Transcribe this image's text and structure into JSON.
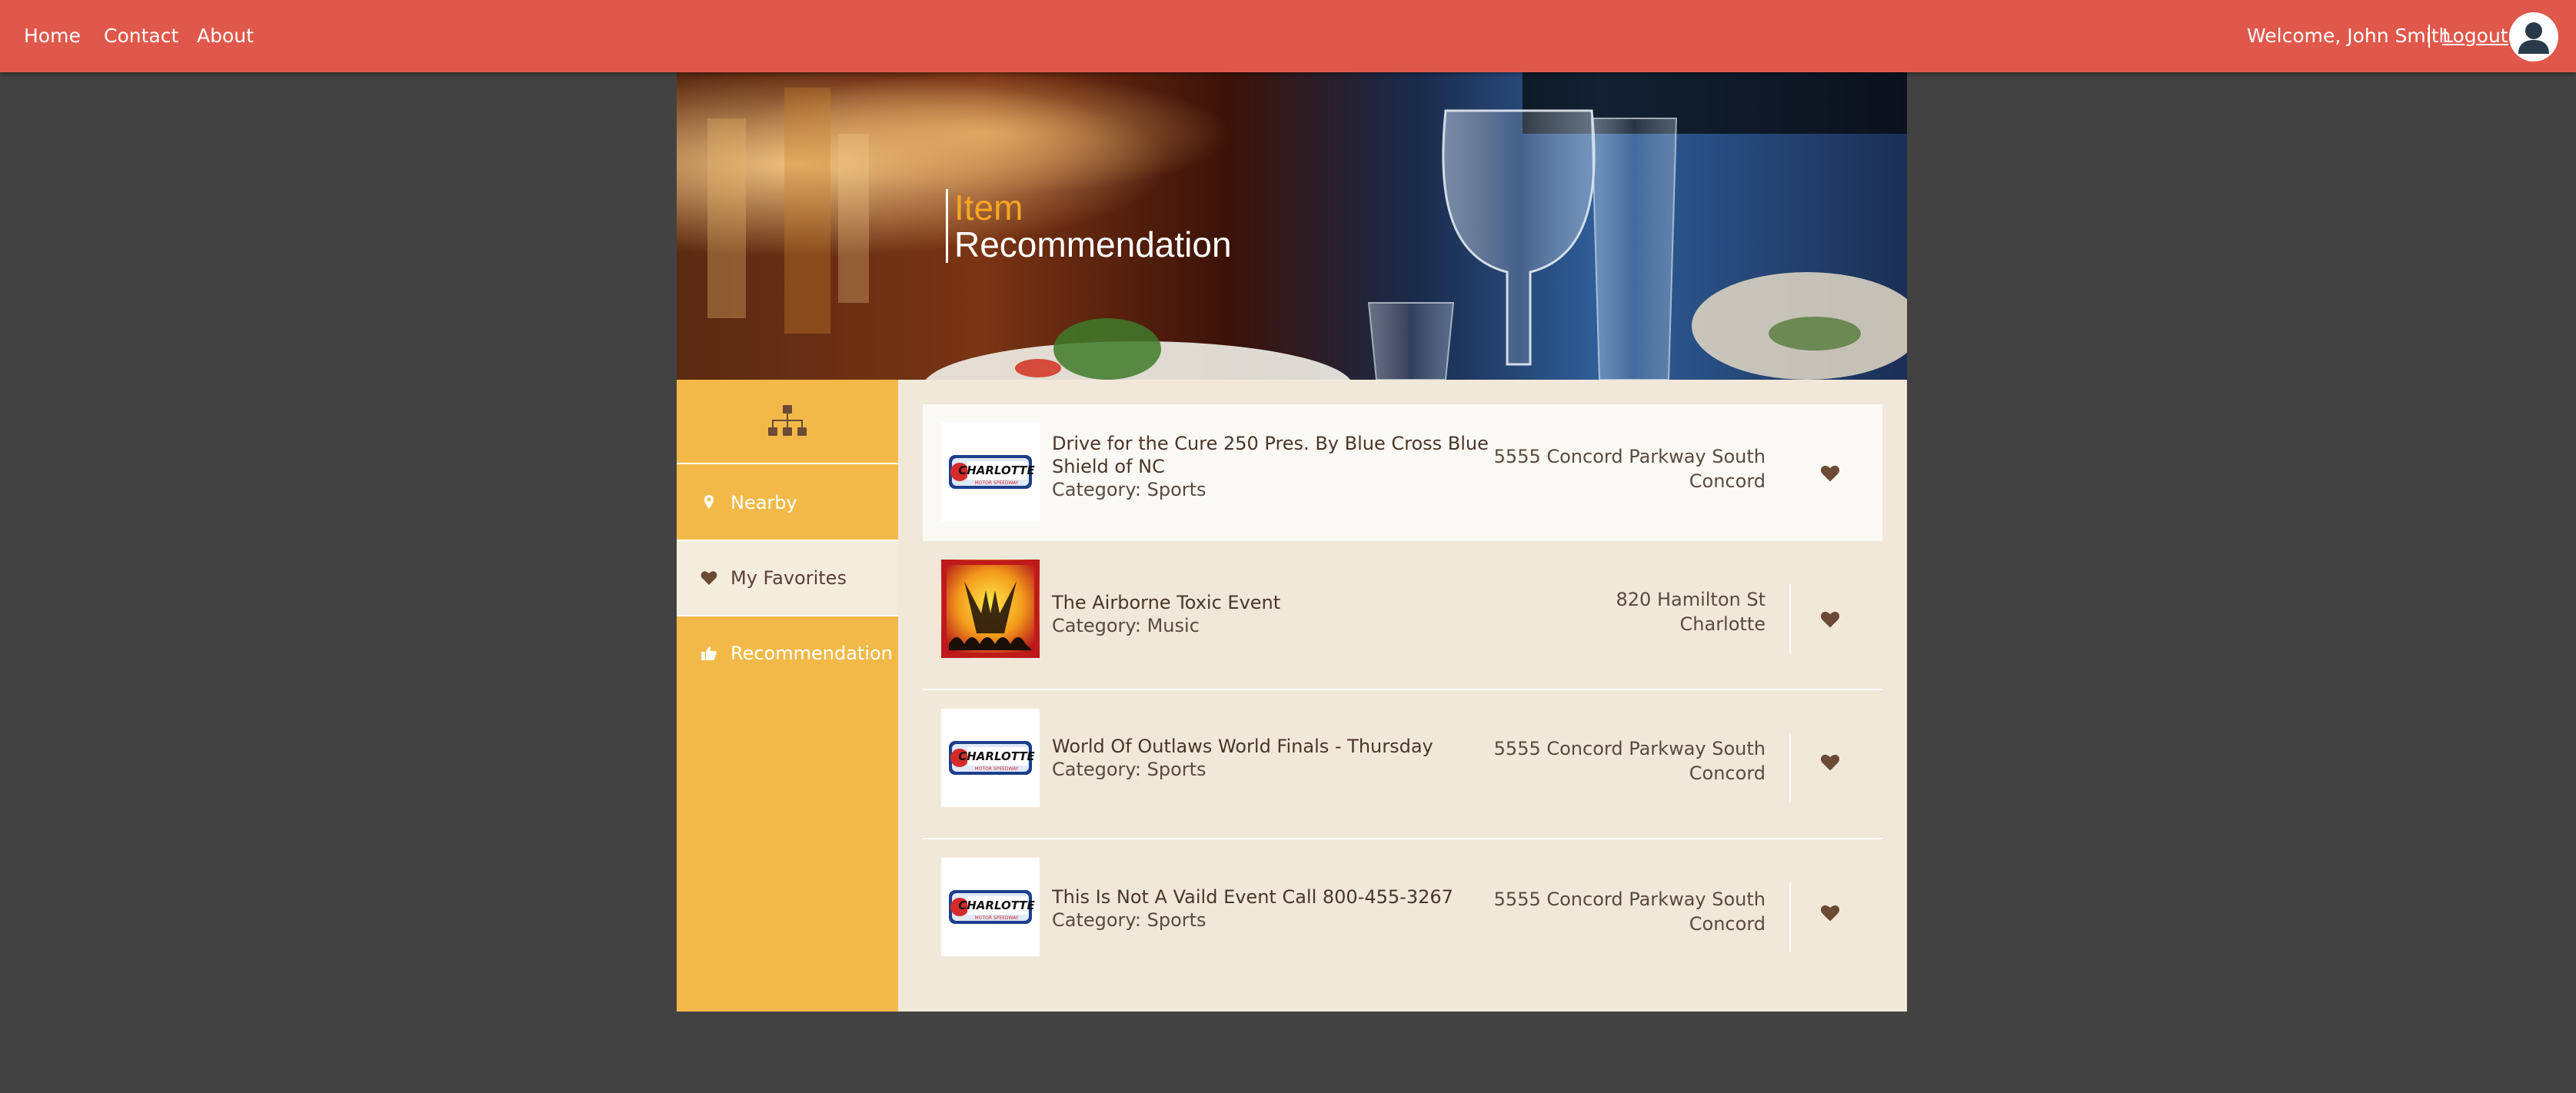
{
  "nav": {
    "home": "Home",
    "contact": "Contact",
    "about": "About",
    "welcome": "Welcome, John Smith",
    "logout": "Logout"
  },
  "hero": {
    "title_line1": "Item",
    "title_line2": "Recommendation"
  },
  "sidebar": {
    "top_icon": "sitemap-icon",
    "items": [
      {
        "label": "Nearby",
        "icon": "map-marker-icon",
        "active": false
      },
      {
        "label": "My Favorites",
        "icon": "heart-icon",
        "active": true
      },
      {
        "label": "Recommendation",
        "icon": "thumbs-up-icon",
        "active": false
      }
    ]
  },
  "items": [
    {
      "name": "Drive for the Cure 250 Pres. By Blue Cross Blue Shield of NC",
      "category": "Category: Sports",
      "address_line1": "5555 Concord Parkway South",
      "address_line2": "Concord",
      "thumb": "charlotte-motor-speedway-logo"
    },
    {
      "name": "The Airborne Toxic Event",
      "category": "Category: Music",
      "address_line1": "820 Hamilton St",
      "address_line2": "Charlotte",
      "thumb": "concert-image"
    },
    {
      "name": "World Of Outlaws World Finals - Thursday",
      "category": "Category: Sports",
      "address_line1": "5555 Concord Parkway South",
      "address_line2": "Concord",
      "thumb": "charlotte-motor-speedway-logo"
    },
    {
      "name": "This Is Not A Vaild Event Call 800-455-3267",
      "category": "Category: Sports",
      "address_line1": "5555 Concord Parkway South",
      "address_line2": "Concord",
      "thumb": "charlotte-motor-speedway-logo"
    }
  ],
  "logo_text": {
    "main": "CHARLOTTE",
    "sub": "MOTOR SPEEDWAY"
  },
  "colors": {
    "topbar": "#e0584b",
    "sidebar": "#f3b948",
    "content_bg": "#f1e8d9",
    "page_bg": "#424242",
    "accent_text": "#f5a623",
    "heart": "#6b4a36"
  }
}
